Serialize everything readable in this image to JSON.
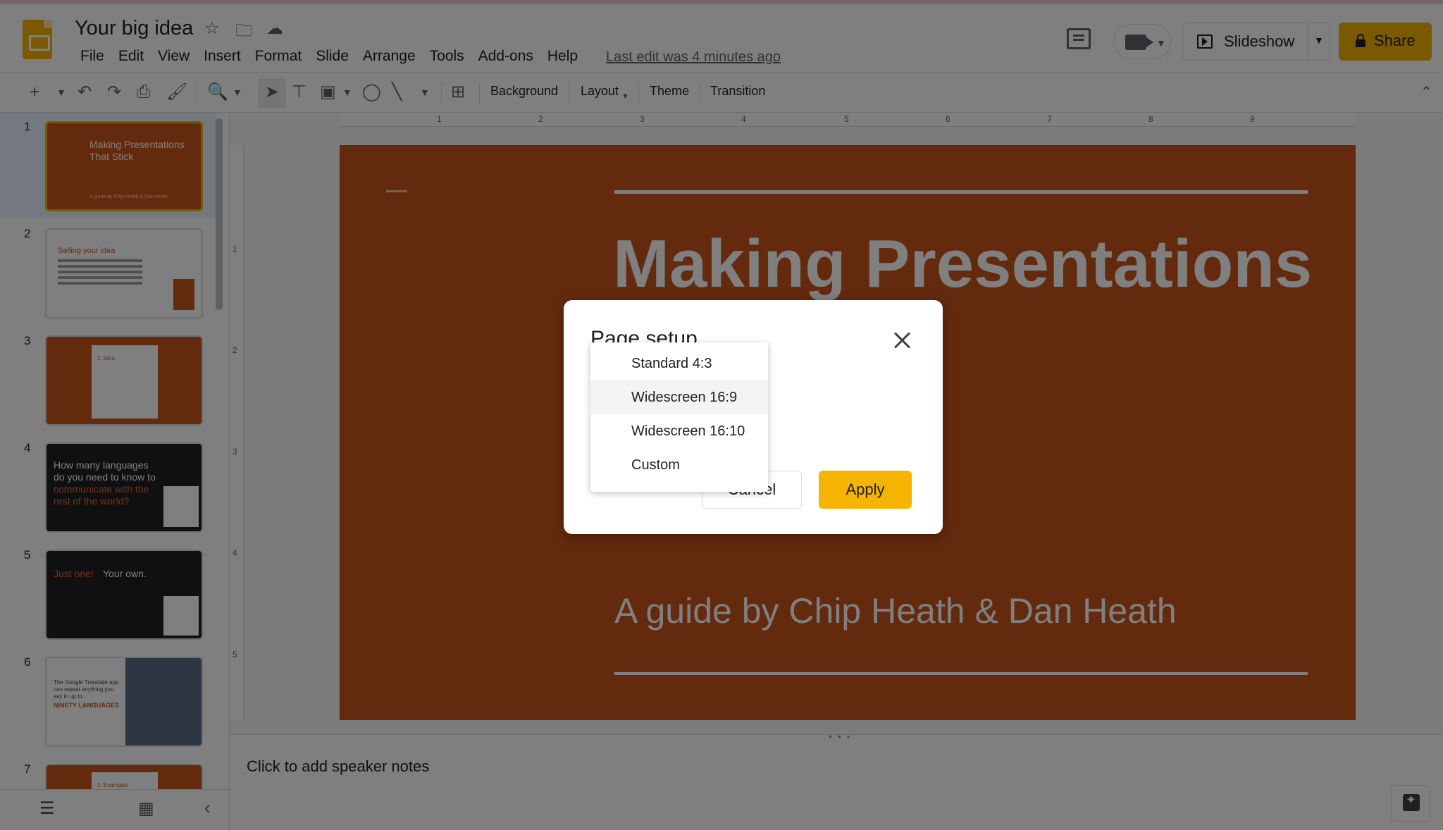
{
  "header": {
    "doc_title": "Your big idea",
    "menus": [
      "File",
      "Edit",
      "View",
      "Insert",
      "Format",
      "Slide",
      "Arrange",
      "Tools",
      "Add-ons",
      "Help"
    ],
    "last_edit": "Last edit was 4 minutes ago",
    "slideshow_label": "Slideshow",
    "share_label": "Share"
  },
  "toolbar": {
    "background_label": "Background",
    "layout_label": "Layout",
    "theme_label": "Theme",
    "transition_label": "Transition"
  },
  "ruler": {
    "top_labels": [
      "1",
      "2",
      "3",
      "4",
      "5",
      "6",
      "7",
      "8",
      "9"
    ],
    "left_labels": [
      "1",
      "2",
      "3",
      "4",
      "5"
    ]
  },
  "filmstrip": {
    "slides": [
      {
        "num": "1",
        "text": "Making Presentations That Stick",
        "sub": "A guide by Chip Heath & Dan Heath"
      },
      {
        "num": "2",
        "text": "Selling your idea"
      },
      {
        "num": "3",
        "text": "1. Intro"
      },
      {
        "num": "4",
        "text": "How many languages do you need to know to",
        "accent": "communicate with the rest of the world?"
      },
      {
        "num": "5",
        "accent": "Just one!",
        "text": "Your own."
      },
      {
        "num": "6",
        "text": "The Google Translate app can repeat anything you say in up to",
        "accent": "NINETY LANGUAGES"
      },
      {
        "num": "7",
        "text": "2. Examples"
      }
    ]
  },
  "slide": {
    "title": "Making Presentations That Stick",
    "subtitle": "A guide by Chip Heath & Dan Heath"
  },
  "notes": {
    "placeholder": "Click to add speaker notes"
  },
  "dialog": {
    "title": "Page setup",
    "cancel_label": "Cancel",
    "apply_label": "Apply"
  },
  "dropdown": {
    "options": [
      "Standard 4:3",
      "Widescreen 16:9",
      "Widescreen 16:10",
      "Custom"
    ],
    "highlighted": "Widescreen 16:9"
  },
  "colors": {
    "accent": "#f4b400",
    "slide_bg": "#c8541d"
  }
}
